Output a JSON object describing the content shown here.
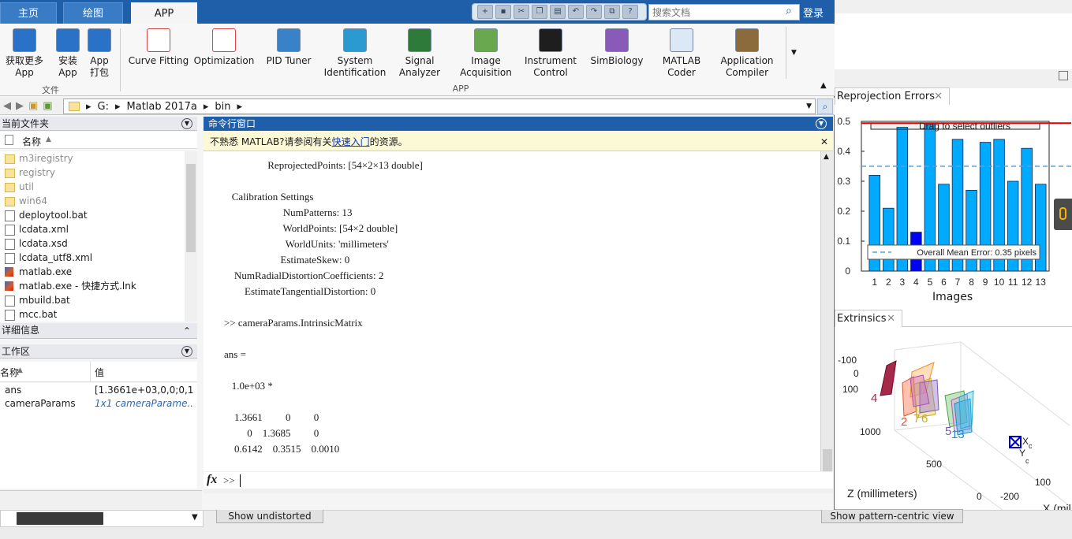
{
  "tabs": [
    "主页",
    "绘图",
    "APP"
  ],
  "search": {
    "placeholder": "搜索文档"
  },
  "login": "登录",
  "toolstrip": {
    "file_buttons": [
      {
        "label1": "获取更多 App",
        "label2": ""
      },
      {
        "label1": "安装",
        "label2": "App"
      },
      {
        "label1": "App",
        "label2": "打包"
      }
    ],
    "apps": [
      {
        "label1": "Curve Fitting",
        "label2": ""
      },
      {
        "label1": "Optimization",
        "label2": ""
      },
      {
        "label1": "PID Tuner",
        "label2": ""
      },
      {
        "label1": "System",
        "label2": "Identification"
      },
      {
        "label1": "Signal",
        "label2": "Analyzer"
      },
      {
        "label1": "Image",
        "label2": "Acquisition"
      },
      {
        "label1": "Instrument",
        "label2": "Control"
      },
      {
        "label1": "SimBiology",
        "label2": ""
      },
      {
        "label1": "MATLAB",
        "label2": "Coder"
      },
      {
        "label1": "Application",
        "label2": "Compiler"
      }
    ],
    "group_file": "文件",
    "group_app": "APP"
  },
  "path": [
    "G:",
    "Matlab 2017a",
    "bin"
  ],
  "current_folder": {
    "title": "当前文件夹",
    "col_name": "名称",
    "items": [
      {
        "name": "m3iregistry",
        "kind": "folder",
        "dim": true
      },
      {
        "name": "registry",
        "kind": "folder",
        "dim": true
      },
      {
        "name": "util",
        "kind": "folder",
        "dim": true
      },
      {
        "name": "win64",
        "kind": "folder",
        "dim": true
      },
      {
        "name": "deploytool.bat",
        "kind": "bat",
        "dim": false
      },
      {
        "name": "lcdata.xml",
        "kind": "file",
        "dim": false
      },
      {
        "name": "lcdata.xsd",
        "kind": "file",
        "dim": false
      },
      {
        "name": "lcdata_utf8.xml",
        "kind": "file",
        "dim": false
      },
      {
        "name": "matlab.exe",
        "kind": "ml",
        "dim": false
      },
      {
        "name": "matlab.exe - 快捷方式.lnk",
        "kind": "ml",
        "dim": false
      },
      {
        "name": "mbuild.bat",
        "kind": "bat",
        "dim": false
      },
      {
        "name": "mcc.bat",
        "kind": "bat",
        "dim": false
      }
    ]
  },
  "details_title": "详细信息",
  "workspace": {
    "title": "工作区",
    "col_name": "名称",
    "col_value": "值",
    "rows": [
      {
        "name": "ans",
        "value": "[1.3661e+03,0,0;0,1..."
      },
      {
        "name": "cameraParams",
        "value": "1x1 cameraParame..."
      }
    ]
  },
  "command_window": {
    "title": "命令行窗口",
    "notice_prefix": "不熟悉 MATLAB?请参阅有关",
    "notice_link": "快速入门",
    "notice_suffix": "的资源。",
    "lines": [
      "                 ReprojectedPoints: [54×2×13 double]",
      "",
      "   Calibration Settings",
      "                       NumPatterns: 13",
      "                       WorldPoints: [54×2 double]",
      "                        WorldUnits: 'millimeters'",
      "                      EstimateSkew: 0",
      "    NumRadialDistortionCoefficients: 2",
      "        EstimateTangentialDistortion: 0",
      "",
      ">> cameraParams.IntrinsicMatrix",
      "",
      "ans =",
      "",
      "   1.0e+03 *",
      "",
      "    1.3661         0         0",
      "         0    1.3685         0",
      "    0.6142    0.3515    0.0010"
    ],
    "prompt": ">>",
    "fx": "fx"
  },
  "reprojection": {
    "tab": "Reprojection Errors",
    "drag_text": "Drag to select outliers",
    "legend": "Overall Mean Error: 0.35 pixels",
    "xlabel": "Images",
    "ytick_labels": [
      "0",
      "0.1",
      "0.2",
      "0.3",
      "0.4",
      "0.5"
    ]
  },
  "chart_data": {
    "type": "bar",
    "title": "",
    "categories": [
      "1",
      "2",
      "3",
      "4",
      "5",
      "6",
      "7",
      "8",
      "9",
      "10",
      "11",
      "12",
      "13"
    ],
    "values": [
      0.32,
      0.21,
      0.48,
      0.13,
      0.49,
      0.29,
      0.44,
      0.27,
      0.43,
      0.44,
      0.3,
      0.41,
      0.29
    ],
    "highlight_index": 3,
    "mean": 0.35,
    "xlabel": "Images",
    "ylabel": "",
    "ylim": [
      0,
      0.5
    ],
    "bar_color": "#00aaff",
    "highlight_color": "#0000ff",
    "mean_line_color": "#5da0d8"
  },
  "extrinsics": {
    "tab": "Extrinsics",
    "z_label": "Z (millimeters)",
    "x_label": "X (mil",
    "y_ticks": [
      "-100",
      "0",
      "100"
    ],
    "z_ticks": [
      "1000",
      "500",
      "0"
    ],
    "x_ticks": [
      "-200",
      "100"
    ],
    "labels": [
      "4",
      "2",
      "7",
      "6",
      "5",
      "13"
    ],
    "cam_x": "X",
    "cam_y": "Y",
    "cam_sub": "c"
  },
  "buttons": {
    "show_undistorted": "Show undistorted",
    "show_pattern": "Show pattern-centric view"
  }
}
